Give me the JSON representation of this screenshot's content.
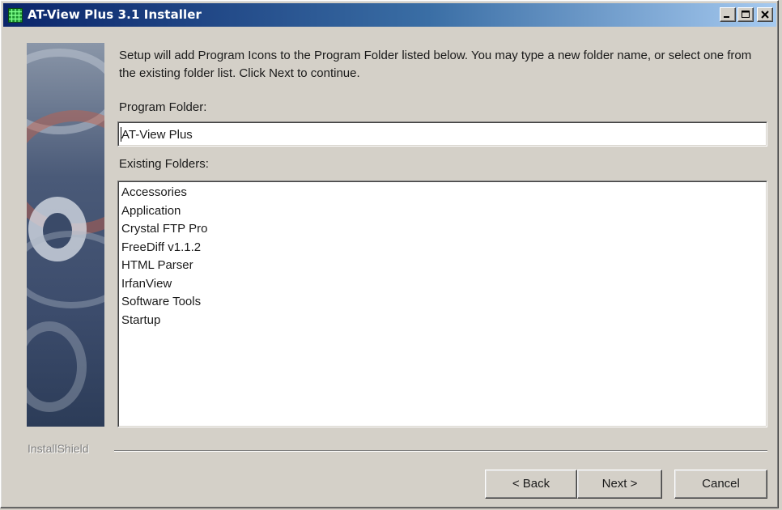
{
  "window": {
    "title": "AT-View Plus 3.1 Installer",
    "controls": [
      "minimize-icon",
      "maximize-icon",
      "close-icon"
    ]
  },
  "main": {
    "description": "Setup will add Program Icons to the Program Folder listed below. You may type a new folder name, or select one from the existing folder list. Click Next to continue.",
    "program_folder_label": "Program Folder:",
    "program_folder_value": "AT-View Plus",
    "existing_folders_label": "Existing Folders:",
    "existing_folders": [
      "Accessories",
      "Application",
      "Crystal FTP Pro",
      "FreeDiff v1.1.2",
      "HTML Parser",
      "IrfanView",
      "Software Tools",
      "Startup"
    ]
  },
  "footer": {
    "brand": "InstallShield",
    "back_label": "< Back",
    "next_label": "Next >",
    "cancel_label": "Cancel"
  },
  "colors": {
    "titlebar_start": "#0a246a",
    "titlebar_end": "#a6caf0",
    "face": "#d4d0c8"
  }
}
